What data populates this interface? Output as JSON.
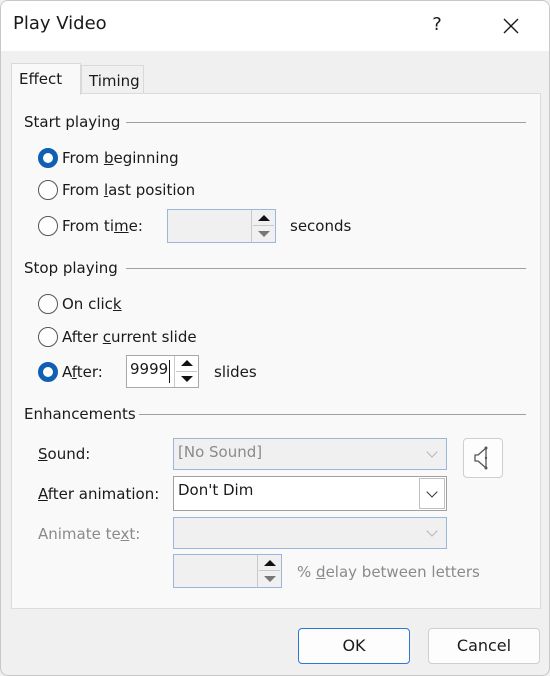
{
  "window": {
    "title": "Play Video",
    "help_label": "?",
    "close_icon": "close-icon"
  },
  "tabs": [
    {
      "label": "Effect",
      "active": true
    },
    {
      "label": "Timing",
      "active": false
    }
  ],
  "start_playing": {
    "label": "Start playing",
    "options": {
      "from_beginning": {
        "pre": "From ",
        "ul": "b",
        "post": "eginning",
        "checked": true
      },
      "from_last_position": {
        "pre": "From ",
        "ul": "l",
        "post": "ast position",
        "checked": false
      },
      "from_time": {
        "pre": "From ti",
        "ul": "m",
        "post": "e:",
        "checked": false
      }
    },
    "time_value": "",
    "time_unit": "seconds"
  },
  "stop_playing": {
    "label": "Stop playing",
    "options": {
      "on_click": {
        "pre": "On clic",
        "ul": "k",
        "post": "",
        "checked": false
      },
      "after_current_slide": {
        "pre": "After ",
        "ul": "c",
        "post": "urrent slide",
        "checked": false
      },
      "after": {
        "pre": "A",
        "ul": "f",
        "post": "ter:",
        "checked": true
      }
    },
    "after_value": "9999",
    "after_unit": "slides"
  },
  "enhancements": {
    "label": "Enhancements",
    "sound": {
      "ul": "S",
      "post": "ound:",
      "value": "[No Sound]",
      "disabled": true
    },
    "after_animation": {
      "ul": "A",
      "post": "fter animation:",
      "value": "Don't Dim"
    },
    "animate_text": {
      "pre": "Animate te",
      "ul": "x",
      "post": "t:",
      "value": "",
      "disabled": true
    },
    "delay": {
      "value": "",
      "pre": "% ",
      "ul": "d",
      "post": "elay between letters"
    },
    "sound_button_icon": "speaker-icon"
  },
  "buttons": {
    "ok": "OK",
    "cancel": "Cancel"
  },
  "colors": {
    "accent": "#0f5fb5",
    "ok_border": "#2b79d4"
  }
}
